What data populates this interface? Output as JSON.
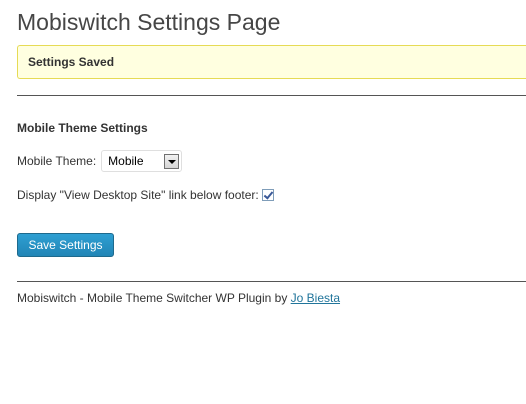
{
  "page": {
    "title": "Mobiswitch Settings Page"
  },
  "notice": {
    "text": "Settings Saved"
  },
  "section": {
    "heading": "Mobile Theme Settings"
  },
  "theme_field": {
    "label": "Mobile Theme:",
    "selected": "Mobile"
  },
  "desktop_link_field": {
    "label": "Display \"View Desktop Site\" link below footer:",
    "checked": true
  },
  "save_button": {
    "label": "Save Settings"
  },
  "footer": {
    "text": "Mobiswitch - Mobile Theme Switcher WP Plugin by ",
    "author_link": "Jo Biesta"
  },
  "colors": {
    "title": "#464646",
    "notice_bg": "#ffffe0",
    "notice_border": "#e6db55",
    "button_bg": "#2185b6",
    "link": "#21759b"
  },
  "icons": {
    "select_arrow": "chevron-down-icon",
    "checkbox": "checkmark-icon"
  }
}
